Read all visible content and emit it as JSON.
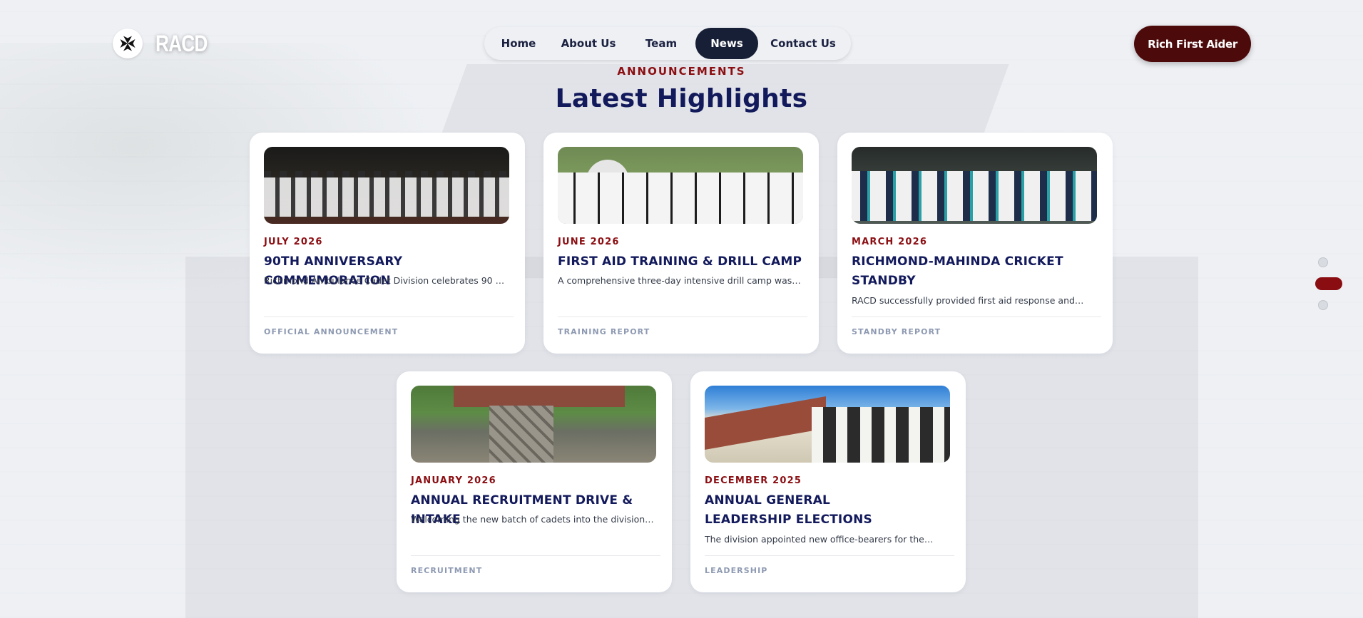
{
  "brand": {
    "name": "RACD",
    "logo_icon": "maltese-cross-icon"
  },
  "nav": {
    "items": [
      {
        "label": "Home",
        "active": false
      },
      {
        "label": "About Us",
        "active": false
      },
      {
        "label": "Team",
        "active": false
      },
      {
        "label": "News",
        "active": true
      },
      {
        "label": "Contact Us",
        "active": false
      }
    ]
  },
  "cta": {
    "label": "Rich First Aider"
  },
  "section": {
    "eyebrow": "ANNOUNCEMENTS",
    "title": "Latest Highlights"
  },
  "cards": [
    {
      "date": "JULY 2026",
      "title": "90TH ANNIVERSARY COMMEMORATION",
      "excerpt": "Richmond Ambulance Cadet Division celebrates 90 yea…",
      "tag": "OFFICIAL ANNOUNCEMENT",
      "image": "night-parade-photo"
    },
    {
      "date": "JUNE 2026",
      "title": "FIRST AID TRAINING & DRILL CAMP",
      "excerpt": "A comprehensive three-day intensive drill camp was hel…",
      "tag": "TRAINING REPORT",
      "image": "drill-camp-photo"
    },
    {
      "date": "MARCH 2026",
      "title": "RICHMOND-MAHINDA CRICKET STANDBY",
      "excerpt": "RACD successfully provided first aid response and…",
      "tag": "STANDBY REPORT",
      "image": "cricket-team-photo"
    },
    {
      "date": "JANUARY 2026",
      "title": "ANNUAL RECRUITMENT DRIVE & INTAKE",
      "excerpt": "Welcoming the new batch of cadets into the division.…",
      "tag": "RECRUITMENT",
      "image": "stone-house-photo"
    },
    {
      "date": "DECEMBER 2025",
      "title": "ANNUAL GENERAL LEADERSHIP ELECTIONS",
      "excerpt": "The division appointed new office-bearers for the…",
      "tag": "LEADERSHIP",
      "image": "school-building-photo"
    }
  ],
  "pagination": {
    "count": 3,
    "active_index": 1
  },
  "colors": {
    "accent": "#8b0e12",
    "navy": "#131a5c",
    "cta_bg": "#4d0a0a",
    "nav_active": "#171f36"
  }
}
